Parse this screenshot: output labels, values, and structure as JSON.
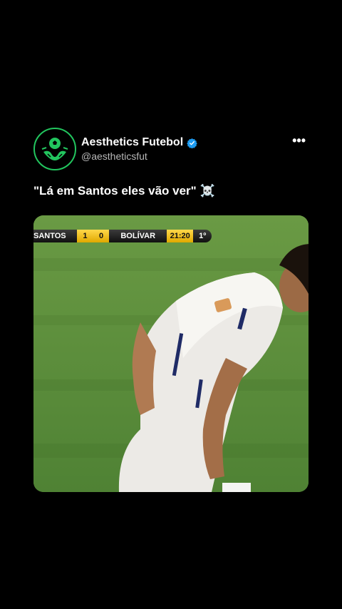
{
  "post": {
    "display_name": "Aesthetics Futebol",
    "handle": "@aestheticsfut",
    "verified_icon": "verified-badge-icon",
    "more_label": "•••",
    "text": "\"Lá em Santos eles vão ver\" ☠️"
  },
  "video": {
    "scorebar": {
      "team_home": "SANTOS",
      "score_home": "1",
      "score_away": "0",
      "team_away": "BOLÍVAR",
      "clock": "21:20",
      "period": "1º"
    }
  },
  "colors": {
    "background": "#000000",
    "avatar_accent": "#22c55e",
    "verified": "#1d9bf0",
    "handle": "#b8b8b8",
    "pitch": "#5b8f3a",
    "scorebar_yellow": "#f2c21c"
  }
}
